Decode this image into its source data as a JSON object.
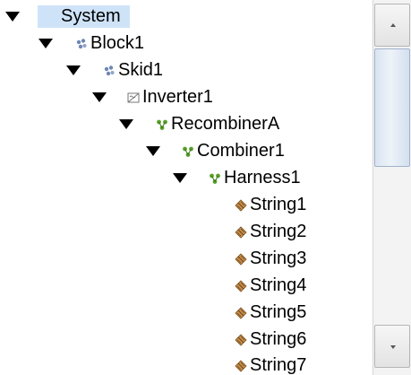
{
  "tree": {
    "nodes": [
      {
        "label": "System",
        "icon": "system-icon",
        "expanded": true,
        "selected": true
      },
      {
        "label": "Block1",
        "icon": "block-icon",
        "expanded": true
      },
      {
        "label": "Skid1",
        "icon": "skid-icon",
        "expanded": true
      },
      {
        "label": "Inverter1",
        "icon": "inverter-icon",
        "expanded": true
      },
      {
        "label": "RecombinerA",
        "icon": "recombiner-icon",
        "expanded": true
      },
      {
        "label": "Combiner1",
        "icon": "combiner-icon",
        "expanded": true
      },
      {
        "label": "Harness1",
        "icon": "harness-icon",
        "expanded": true
      },
      {
        "label": "String1",
        "icon": "string-icon"
      },
      {
        "label": "String2",
        "icon": "string-icon"
      },
      {
        "label": "String3",
        "icon": "string-icon"
      },
      {
        "label": "String4",
        "icon": "string-icon"
      },
      {
        "label": "String5",
        "icon": "string-icon"
      },
      {
        "label": "String6",
        "icon": "string-icon"
      },
      {
        "label": "String7",
        "icon": "string-icon"
      }
    ]
  },
  "colors": {
    "selection": "#cfe3f8",
    "block_icon": "#6f86b6",
    "recombiner_icon": "#5aa02c",
    "string_icon": "#9b6a2e",
    "scroll_thumb": "#dfe8f3"
  }
}
